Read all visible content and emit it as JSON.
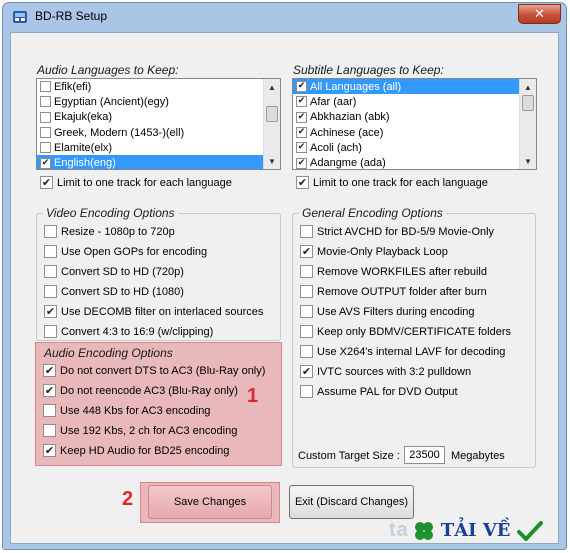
{
  "window": {
    "title": "BD-RB Setup",
    "close_glyph": "✕"
  },
  "audio_languages": {
    "label": "Audio Languages to Keep:",
    "items": [
      {
        "label": "Efik(efi)",
        "checked": false,
        "selected": false
      },
      {
        "label": "Egyptian (Ancient)(egy)",
        "checked": false,
        "selected": false
      },
      {
        "label": "Ekajuk(eka)",
        "checked": false,
        "selected": false
      },
      {
        "label": "Greek, Modern (1453-)(ell)",
        "checked": false,
        "selected": false
      },
      {
        "label": "Elamite(elx)",
        "checked": false,
        "selected": false
      },
      {
        "label": "English(eng)",
        "checked": true,
        "selected": true
      }
    ],
    "limit_label": "Limit to one track for each language",
    "limit_checked": true
  },
  "subtitle_languages": {
    "label": "Subtitle Languages to Keep:",
    "items": [
      {
        "label": "All Languages (all)",
        "checked": true,
        "selected": true
      },
      {
        "label": "Afar (aar)",
        "checked": true,
        "selected": false
      },
      {
        "label": "Abkhazian (abk)",
        "checked": true,
        "selected": false
      },
      {
        "label": "Achinese (ace)",
        "checked": true,
        "selected": false
      },
      {
        "label": "Acoli (ach)",
        "checked": true,
        "selected": false
      },
      {
        "label": "Adangme (ada)",
        "checked": true,
        "selected": false
      }
    ],
    "limit_label": "Limit to one track for each language",
    "limit_checked": true
  },
  "video_encoding": {
    "title": "Video Encoding Options",
    "options": [
      {
        "label": "Resize  - 1080p to 720p",
        "checked": false
      },
      {
        "label": "Use Open GOPs for encoding",
        "checked": false
      },
      {
        "label": "Convert SD to HD (720p)",
        "checked": false
      },
      {
        "label": "Convert SD to HD (1080)",
        "checked": false
      },
      {
        "label": "Use DECOMB filter on interlaced sources",
        "checked": true
      },
      {
        "label": "Convert 4:3 to 16:9 (w/clipping)",
        "checked": false
      }
    ]
  },
  "audio_encoding": {
    "title": "Audio Encoding Options",
    "options": [
      {
        "label": "Do not convert DTS to AC3  (Blu-Ray only)",
        "checked": true
      },
      {
        "label": "Do not reencode AC3  (Blu-Ray only)",
        "checked": true
      },
      {
        "label": "Use 448 Kbs for AC3 encoding",
        "checked": false
      },
      {
        "label": "Use 192 Kbs, 2 ch for AC3 encoding",
        "checked": false
      },
      {
        "label": "Keep HD Audio for BD25 encoding",
        "checked": true
      }
    ]
  },
  "general_encoding": {
    "title": "General Encoding Options",
    "options": [
      {
        "label": "Strict AVCHD for BD-5/9 Movie-Only",
        "checked": false
      },
      {
        "label": "Movie-Only Playback Loop",
        "checked": true
      },
      {
        "label": "Remove WORKFILES after rebuild",
        "checked": false
      },
      {
        "label": "Remove OUTPUT folder after burn",
        "checked": false
      },
      {
        "label": "Use AVS Filters during encoding",
        "checked": false
      },
      {
        "label": "Keep only BDMV/CERTIFICATE folders",
        "checked": false
      },
      {
        "label": "Use X264's internal LAVF for decoding",
        "checked": false
      },
      {
        "label": "IVTC sources with 3:2 pulldown",
        "checked": true
      },
      {
        "label": "Assume PAL for DVD Output",
        "checked": false
      }
    ],
    "target_size_label": "Custom Target Size :",
    "target_size_value": "23500",
    "target_size_unit": "Megabytes"
  },
  "buttons": {
    "save": "Save Changes",
    "exit": "Exit (Discard Changes)"
  },
  "callouts": {
    "one": "1",
    "two": "2"
  },
  "watermark": {
    "left_text": "ta",
    "brand": "TẢI VỀ"
  },
  "colors": {
    "highlight": "#e8b8bb",
    "callout": "#e0262d",
    "selection": "#3399ff",
    "brand_blue": "#1b3f9c",
    "brand_green": "#1e8f2e"
  },
  "icons": {
    "app": "bd-rb-app-icon",
    "check": "checkmark-icon",
    "scroll_up": "scroll-up-icon",
    "scroll_down": "scroll-down-icon",
    "clover": "clover-icon"
  }
}
